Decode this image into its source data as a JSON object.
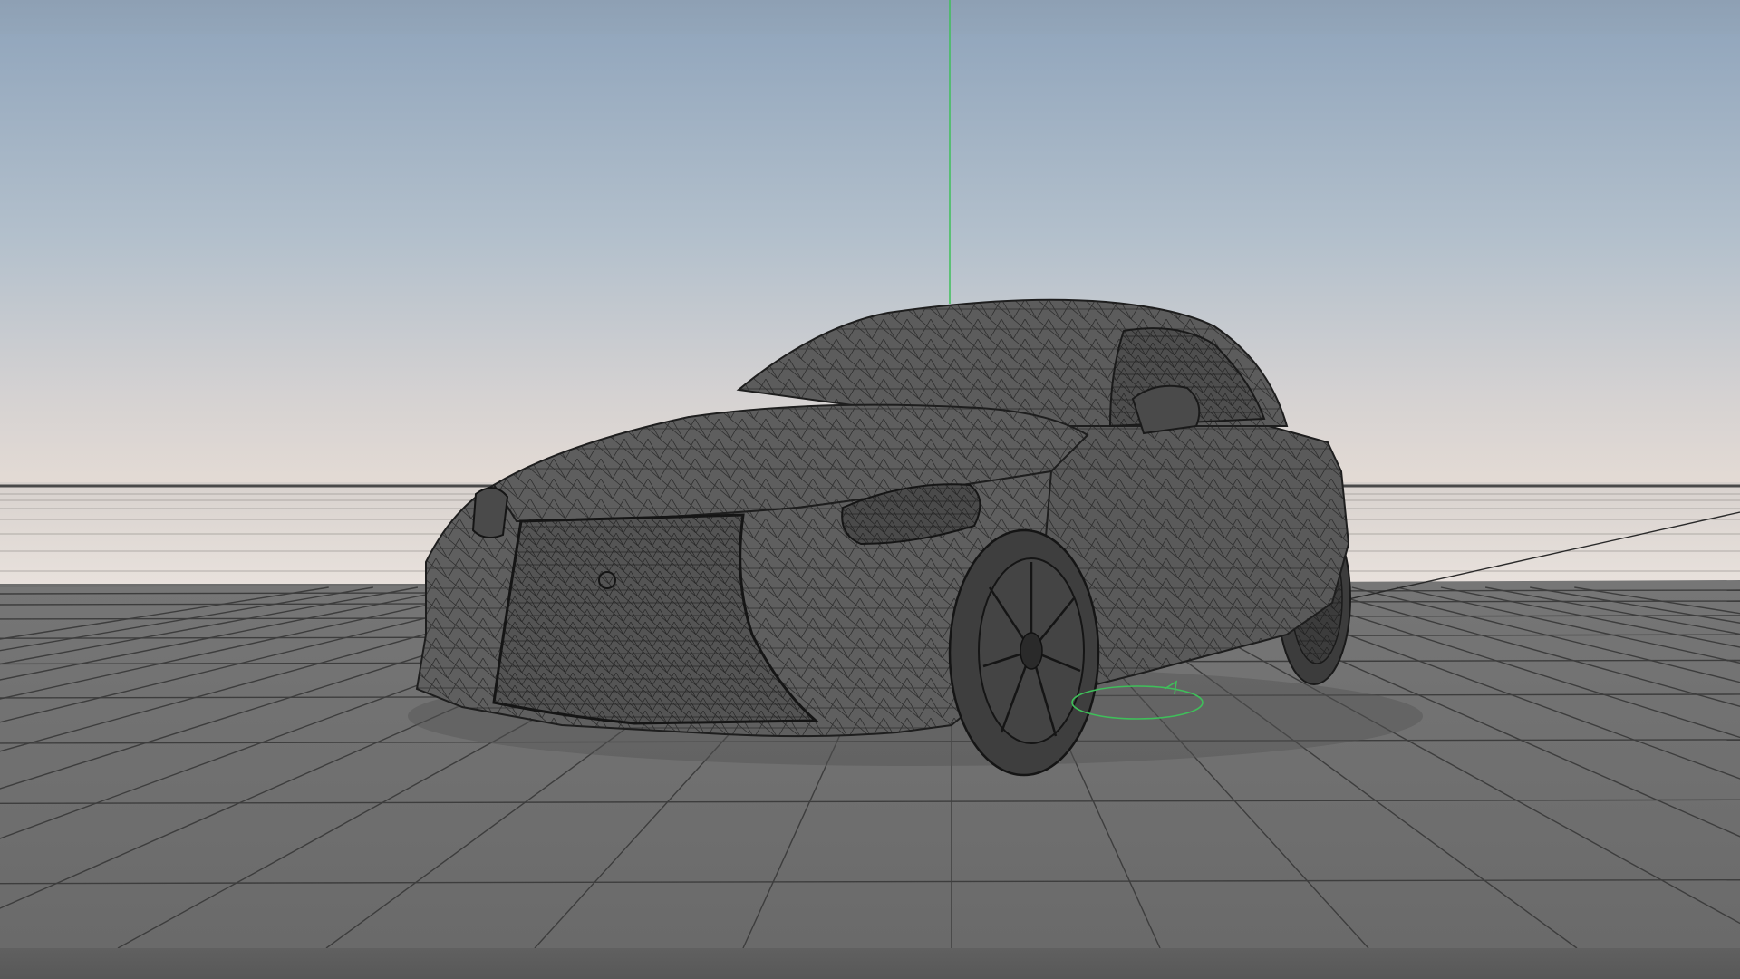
{
  "app": {
    "name": "",
    "view": "3d-viewport"
  },
  "scene": {
    "object": "car-wireframe-model",
    "display_mode": "wireframe-on-shaded",
    "ground_grid": true,
    "axis_visible": true
  },
  "colors": {
    "sky_top": "#93a7bd",
    "sky_mid": "#a9bacb",
    "sky_horizon": "#e2d8d2",
    "ground": "#6e6e6e",
    "grid_line": "#3a3a3a",
    "wire": "#1e1e1e",
    "body_fill": "#5e5e5e",
    "axis_green": "#3fbf5a"
  }
}
